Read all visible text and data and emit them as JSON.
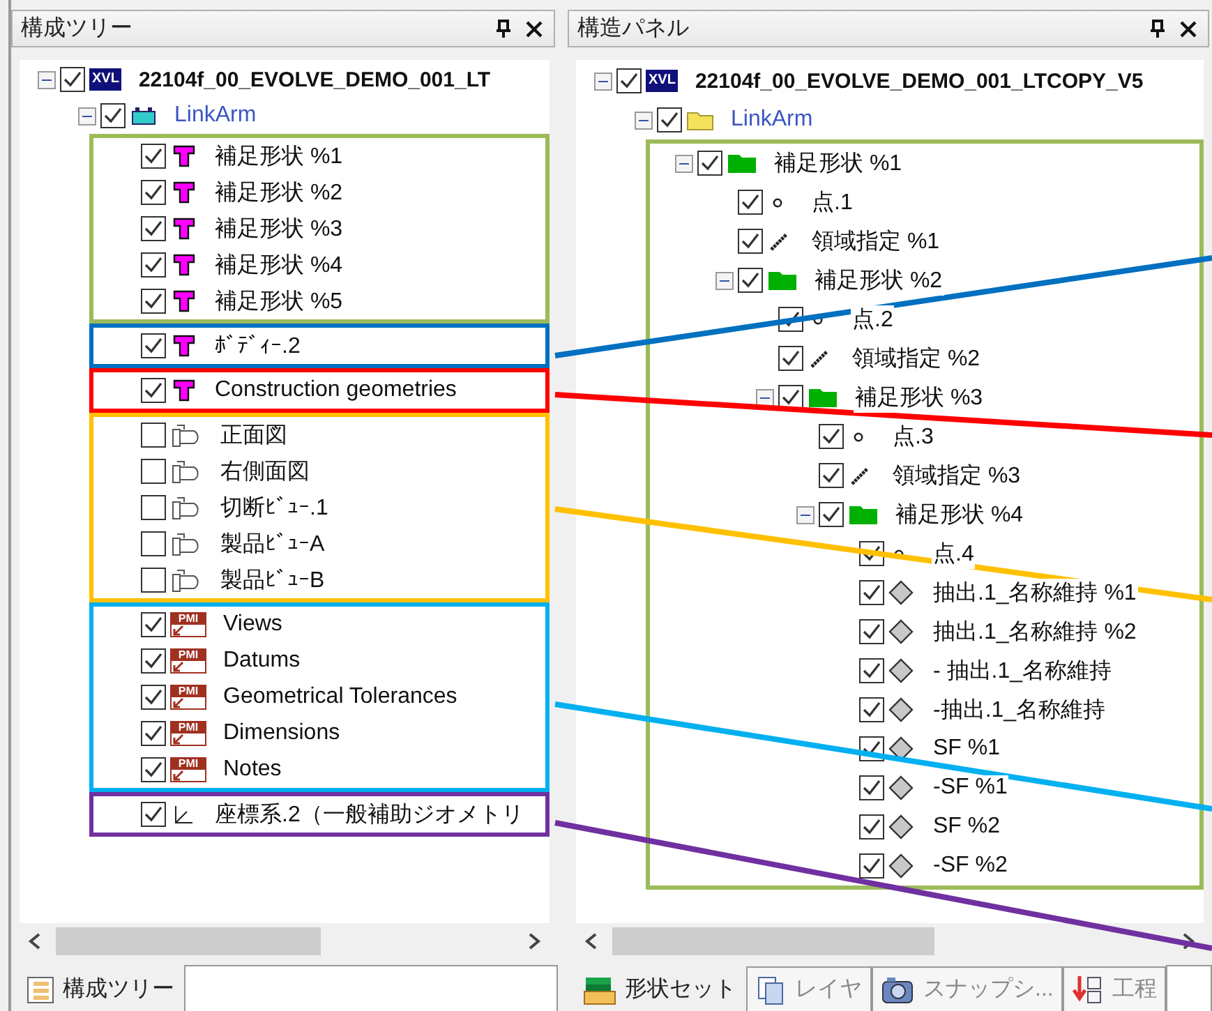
{
  "panels": [
    {
      "title": "構成ツリー",
      "tree": {
        "kind": "xvl",
        "badge": "XVL",
        "label": "22104f_00_EVOLVE_DEMO_001_LT",
        "checked": true,
        "expanded": true,
        "children": [
          {
            "kind": "part",
            "label": "LinkArm",
            "checked": true,
            "expanded": true,
            "groups": [
              {
                "color": "#9bbb59",
                "connector": false,
                "items": [
                  {
                    "kind": "body",
                    "label": "補足形状 %1",
                    "checked": true
                  },
                  {
                    "kind": "body",
                    "label": "補足形状 %2",
                    "checked": true
                  },
                  {
                    "kind": "body",
                    "label": "補足形状 %3",
                    "checked": true
                  },
                  {
                    "kind": "body",
                    "label": "補足形状 %4",
                    "checked": true
                  },
                  {
                    "kind": "body",
                    "label": "補足形状 %5",
                    "checked": true
                  }
                ]
              },
              {
                "color": "#0070c0",
                "connector": true,
                "items": [
                  {
                    "kind": "body",
                    "label": "ﾎﾞﾃﾞｨｰ.2",
                    "checked": true
                  }
                ]
              },
              {
                "color": "#ff0000",
                "connector": true,
                "items": [
                  {
                    "kind": "body",
                    "label": "Construction geometries",
                    "checked": true
                  }
                ]
              },
              {
                "color": "#ffc000",
                "connector": true,
                "items": [
                  {
                    "kind": "view",
                    "label": "正面図",
                    "checked": false
                  },
                  {
                    "kind": "view",
                    "label": "右側面図",
                    "checked": false
                  },
                  {
                    "kind": "view",
                    "label": "切断ﾋﾞｭｰ.1",
                    "checked": false
                  },
                  {
                    "kind": "view",
                    "label": "製品ﾋﾞｭｰA",
                    "checked": false
                  },
                  {
                    "kind": "view",
                    "label": "製品ﾋﾞｭｰB",
                    "checked": false
                  }
                ]
              },
              {
                "color": "#00b0f0",
                "connector": true,
                "items": [
                  {
                    "kind": "pmi",
                    "badge": "PMI",
                    "label": "Views",
                    "checked": true
                  },
                  {
                    "kind": "pmi",
                    "badge": "PMI",
                    "label": "Datums",
                    "checked": true
                  },
                  {
                    "kind": "pmi",
                    "badge": "PMI",
                    "label": "Geometrical Tolerances",
                    "checked": true
                  },
                  {
                    "kind": "pmi",
                    "badge": "PMI",
                    "label": "Dimensions",
                    "checked": true
                  },
                  {
                    "kind": "pmi",
                    "badge": "PMI",
                    "label": "Notes",
                    "checked": true
                  }
                ]
              },
              {
                "color": "#7030a0",
                "connector": true,
                "items": [
                  {
                    "kind": "axis",
                    "label": "座標系.2（一般補助ジオメトリ",
                    "checked": true
                  }
                ]
              }
            ]
          }
        ]
      },
      "tabs": [
        {
          "kind": "tree",
          "label": "構成ツリー",
          "selected": true
        }
      ]
    },
    {
      "title": "構造パネル",
      "tree": {
        "kind": "xvl",
        "badge": "XVL",
        "label": "22104f_00_EVOLVE_DEMO_001_LTCOPY_V5",
        "checked": true,
        "expanded": true,
        "children": [
          {
            "kind": "yfolder",
            "label": "LinkArm",
            "checked": true,
            "expanded": true,
            "groups": [
              {
                "color": "#9bbb59",
                "connector": false,
                "items": [
                  {
                    "kind": "gfolder",
                    "label": "補足形状 %1",
                    "checked": true,
                    "expanded": true,
                    "children": [
                      {
                        "kind": "point",
                        "label": "点.1",
                        "checked": true
                      },
                      {
                        "kind": "line",
                        "label": "領域指定 %1",
                        "checked": true
                      },
                      {
                        "kind": "gfolder",
                        "label": "補足形状 %2",
                        "checked": true,
                        "expanded": true,
                        "children": [
                          {
                            "kind": "point",
                            "label": "点.2",
                            "checked": true
                          },
                          {
                            "kind": "line",
                            "label": "領域指定 %2",
                            "checked": true
                          },
                          {
                            "kind": "gfolder",
                            "label": "補足形状 %3",
                            "checked": true,
                            "expanded": true,
                            "children": [
                              {
                                "kind": "point",
                                "label": "点.3",
                                "checked": true
                              },
                              {
                                "kind": "line",
                                "label": "領域指定 %3",
                                "checked": true
                              },
                              {
                                "kind": "gfolder",
                                "label": "補足形状 %4",
                                "checked": true,
                                "expanded": true,
                                "children": [
                                  {
                                    "kind": "point",
                                    "label": "点.4",
                                    "checked": true
                                  },
                                  {
                                    "kind": "surface",
                                    "label": "抽出.1_名称維持 %1",
                                    "checked": true
                                  },
                                  {
                                    "kind": "surface",
                                    "label": "抽出.1_名称維持 %2",
                                    "checked": true
                                  },
                                  {
                                    "kind": "surface",
                                    "label": "- 抽出.1_名称維持",
                                    "checked": true
                                  },
                                  {
                                    "kind": "surface",
                                    "label": "-抽出.1_名称維持",
                                    "checked": true
                                  },
                                  {
                                    "kind": "surface",
                                    "label": "SF %1",
                                    "checked": true
                                  },
                                  {
                                    "kind": "surface",
                                    "label": "-SF %1",
                                    "checked": true
                                  },
                                  {
                                    "kind": "surface",
                                    "label": "SF %2",
                                    "checked": true
                                  },
                                  {
                                    "kind": "surface",
                                    "label": "-SF %2",
                                    "checked": true
                                  }
                                ]
                              }
                            ]
                          }
                        ]
                      }
                    ]
                  }
                ]
              }
            ]
          }
        ]
      },
      "tabs": [
        {
          "kind": "shapeset",
          "label": "形状セット",
          "selected": true
        },
        {
          "kind": "layer",
          "label": "レイヤ",
          "selected": false
        },
        {
          "kind": "camera",
          "label": "スナップシ...",
          "selected": false
        },
        {
          "kind": "process",
          "label": "工程",
          "selected": false
        }
      ]
    }
  ]
}
